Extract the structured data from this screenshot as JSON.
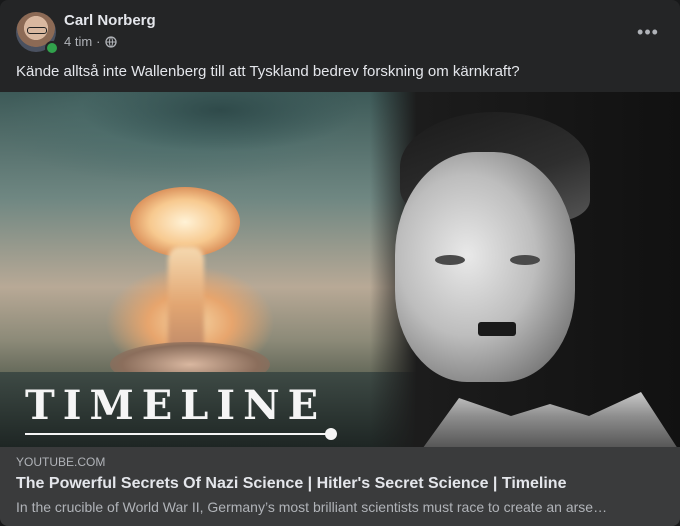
{
  "post": {
    "author": "Carl Norberg",
    "time": "4 tim",
    "separator": "·",
    "privacy_icon": "globe-icon",
    "more_label": "•••",
    "text": "Kände alltså inte Wallenberg till att Tyskland bedrev forskning om kärnkraft?"
  },
  "media": {
    "overlay_title": "TIMELINE"
  },
  "link": {
    "domain": "YOUTUBE.COM",
    "title": "The Powerful Secrets Of Nazi Science | Hitler's Secret Science | Timeline",
    "description": "In the crucible of World War II, Germany’s most brilliant scientists must race to create an arse…"
  },
  "colors": {
    "card_bg": "#242526",
    "link_bg": "#3a3b3c",
    "online": "#31a24c",
    "text_primary": "#e4e6eb",
    "text_secondary": "#b0b3b8"
  }
}
